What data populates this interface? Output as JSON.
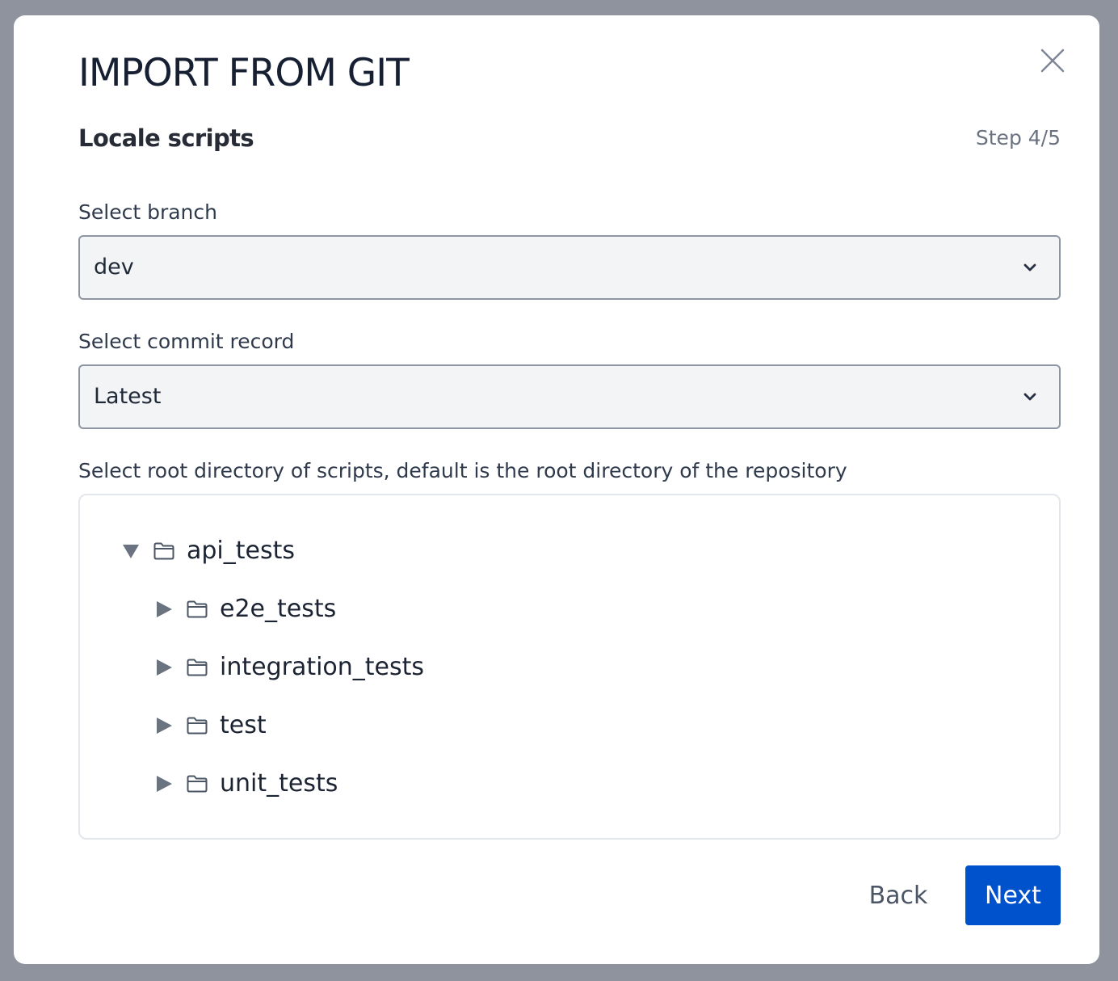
{
  "dialog": {
    "title": "IMPORT FROM GIT",
    "subtitle": "Locale scripts",
    "step": "Step 4/5"
  },
  "branch": {
    "label": "Select branch",
    "value": "dev"
  },
  "commit": {
    "label": "Select commit record",
    "value": "Latest"
  },
  "directory": {
    "label": "Select root directory of scripts, default is the root directory of the repository",
    "tree": {
      "root": {
        "name": "api_tests",
        "expanded": true
      },
      "children": [
        {
          "name": "e2e_tests",
          "expanded": false
        },
        {
          "name": "integration_tests",
          "expanded": false
        },
        {
          "name": "test",
          "expanded": false
        },
        {
          "name": "unit_tests",
          "expanded": false
        }
      ]
    }
  },
  "footer": {
    "back_label": "Back",
    "next_label": "Next"
  },
  "colors": {
    "primary": "#0052cc",
    "overlay": "#8f939d"
  },
  "icons": {
    "close": "close-icon",
    "dropdown": "chevron-down-icon",
    "expanded": "caret-down-icon",
    "collapsed": "caret-right-icon",
    "folder": "folder-icon"
  }
}
